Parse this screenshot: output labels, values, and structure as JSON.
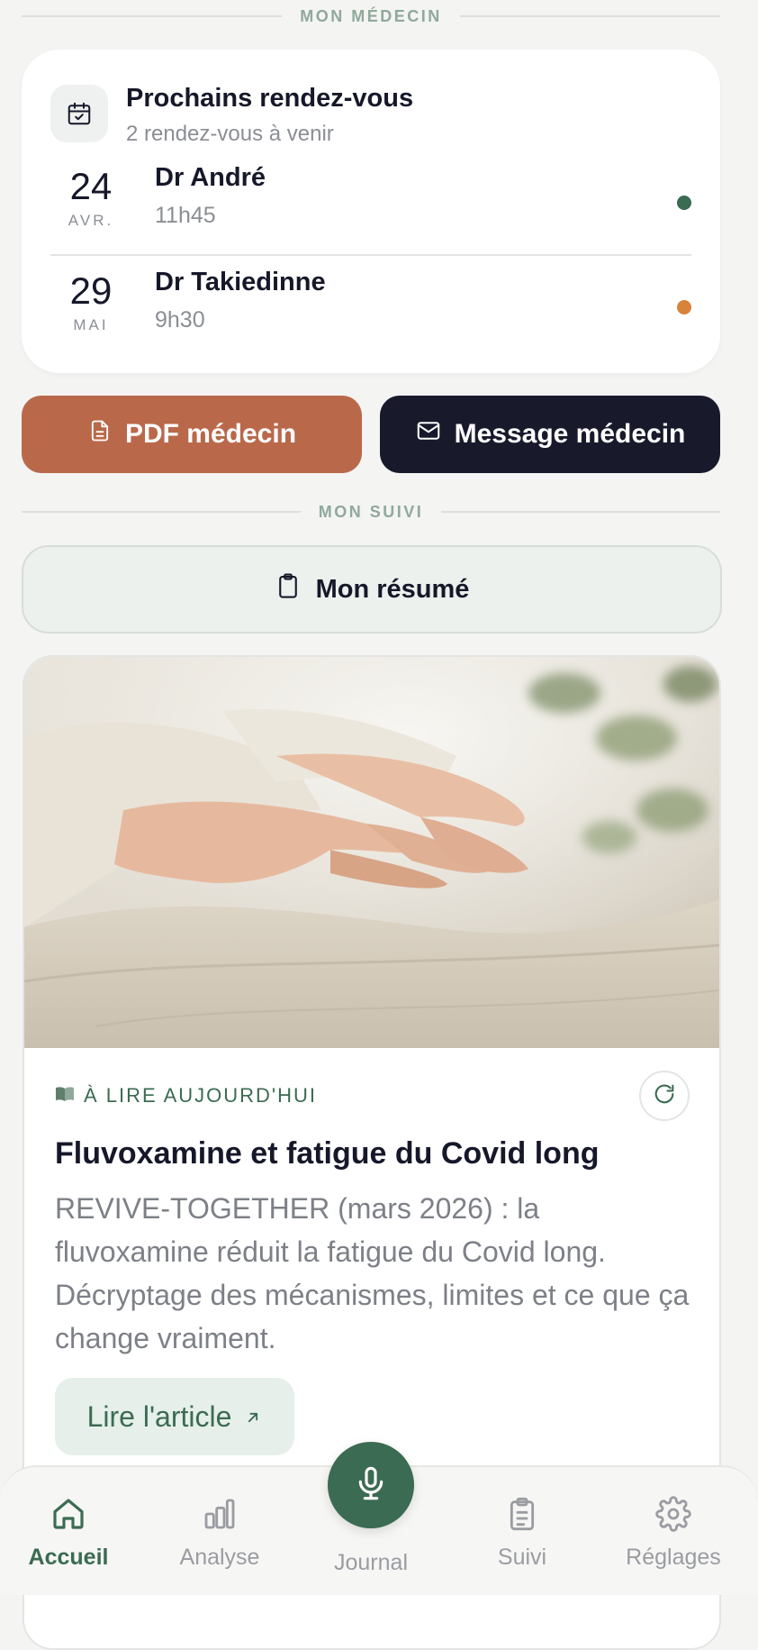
{
  "sections": {
    "doctor": "MON MÉDECIN",
    "tracking": "MON SUIVI"
  },
  "appointments": {
    "title": "Prochains rendez-vous",
    "subtitle": "2 rendez-vous à venir",
    "items": [
      {
        "day": "24",
        "month": "AVR.",
        "doctor": "Dr André",
        "time": "11h45",
        "status_color": "#3b6b52"
      },
      {
        "day": "29",
        "month": "MAI",
        "doctor": "Dr Takiedinne",
        "time": "9h30",
        "status_color": "#d9823a"
      }
    ]
  },
  "actions": {
    "pdf_label": "PDF médecin",
    "message_label": "Message médecin"
  },
  "summary": {
    "label": "Mon résumé"
  },
  "article": {
    "tag": "À LIRE AUJOURD'HUI",
    "title": "Fluvoxamine et fatigue du Covid long",
    "description": "REVIVE-TOGETHER (mars 2026) : la fluvoxamine réduit la fatigue du Covid long. Décryptage des mécanismes, limites et ce que ça change vraiment.",
    "cta": "Lire l'article",
    "image": "hands-on-linen-photo"
  },
  "nav": {
    "home": "Accueil",
    "analysis": "Analyse",
    "journal": "Journal",
    "tracking": "Suivi",
    "settings": "Réglages",
    "active": "Accueil"
  },
  "colors": {
    "accent_green": "#3b6b52",
    "terracotta": "#b9694a",
    "navy": "#181a2c"
  }
}
